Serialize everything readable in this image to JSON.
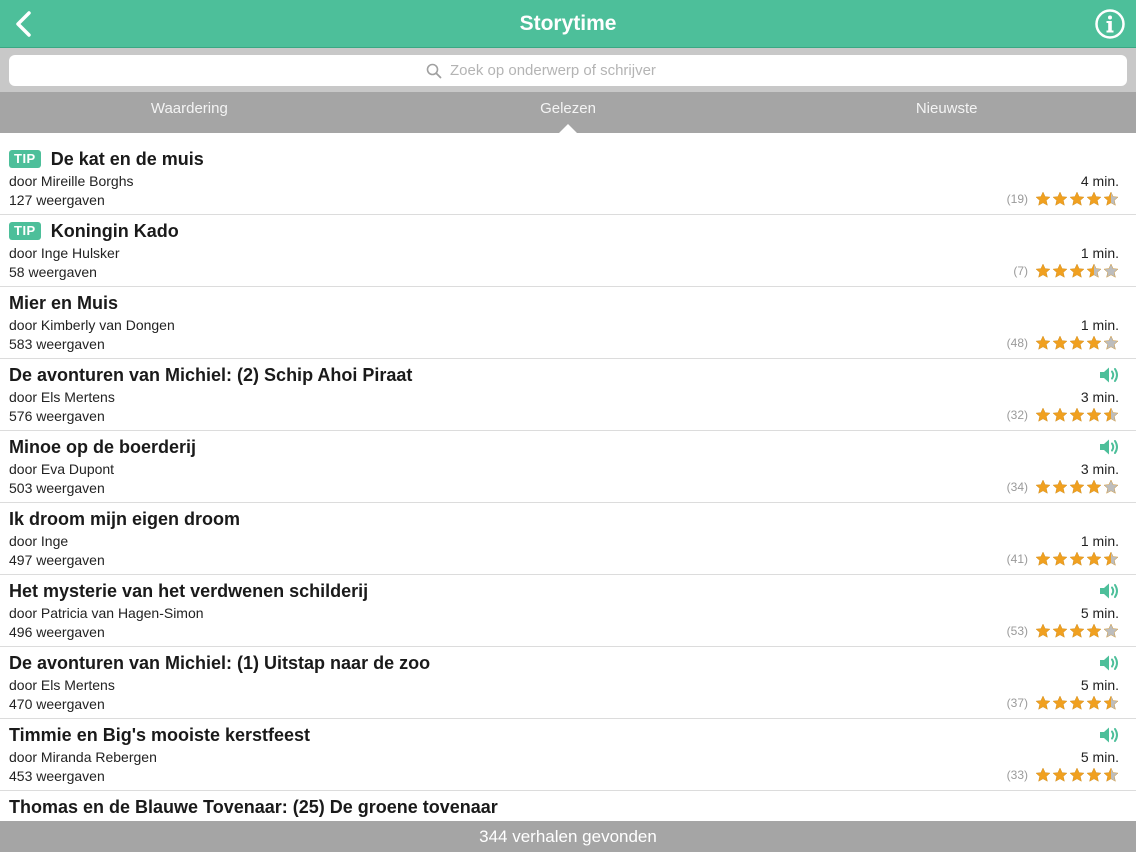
{
  "header": {
    "title": "Storytime"
  },
  "search": {
    "placeholder": "Zoek op onderwerp of schrijver"
  },
  "tabs": [
    {
      "label": "Waardering",
      "active": false
    },
    {
      "label": "Gelezen",
      "active": true
    },
    {
      "label": "Nieuwste",
      "active": false
    }
  ],
  "colors": {
    "accent": "#4dbf9a",
    "star": "#f0a020",
    "star_empty": "#bdbdbd",
    "bar": "#a5a5a5"
  },
  "stories": [
    {
      "tip": "TIP",
      "title": "De kat en de muis",
      "author": "door Mireille Borghs",
      "views": "127 weergaven",
      "duration": "4 min.",
      "count": "(19)",
      "rating": 4.5,
      "audio": false
    },
    {
      "tip": "TIP",
      "title": "Koningin Kado",
      "author": "door Inge Hulsker",
      "views": "58 weergaven",
      "duration": "1 min.",
      "count": "(7)",
      "rating": 3.5,
      "audio": false
    },
    {
      "tip": "",
      "title": "Mier en Muis",
      "author": "door Kimberly van Dongen",
      "views": "583 weergaven",
      "duration": "1 min.",
      "count": "(48)",
      "rating": 4,
      "audio": false
    },
    {
      "tip": "",
      "title": "De avonturen van Michiel: (2) Schip Ahoi Piraat",
      "author": "door Els Mertens",
      "views": "576 weergaven",
      "duration": "3 min.",
      "count": "(32)",
      "rating": 4.5,
      "audio": true
    },
    {
      "tip": "",
      "title": "Minoe op de boerderij",
      "author": "door Eva Dupont",
      "views": "503 weergaven",
      "duration": "3 min.",
      "count": "(34)",
      "rating": 4,
      "audio": true
    },
    {
      "tip": "",
      "title": "Ik droom mijn eigen droom",
      "author": "door Inge",
      "views": "497 weergaven",
      "duration": "1 min.",
      "count": "(41)",
      "rating": 4.5,
      "audio": false
    },
    {
      "tip": "",
      "title": "Het mysterie van het verdwenen schilderij",
      "author": "door Patricia van Hagen-Simon",
      "views": "496 weergaven",
      "duration": "5 min.",
      "count": "(53)",
      "rating": 4,
      "audio": true
    },
    {
      "tip": "",
      "title": "De avonturen van Michiel: (1) Uitstap naar de zoo",
      "author": "door Els Mertens",
      "views": "470 weergaven",
      "duration": "5 min.",
      "count": "(37)",
      "rating": 4.5,
      "audio": true
    },
    {
      "tip": "",
      "title": "Timmie en Big's mooiste kerstfeest",
      "author": "door Miranda Rebergen",
      "views": "453 weergaven",
      "duration": "5 min.",
      "count": "(33)",
      "rating": 4.5,
      "audio": true
    },
    {
      "tip": "",
      "title": "Thomas en de Blauwe Tovenaar: (25) De groene tovenaar",
      "author": "",
      "views": "",
      "duration": "",
      "count": "",
      "rating": 0,
      "audio": false
    }
  ],
  "footer": {
    "text": "344 verhalen gevonden"
  }
}
